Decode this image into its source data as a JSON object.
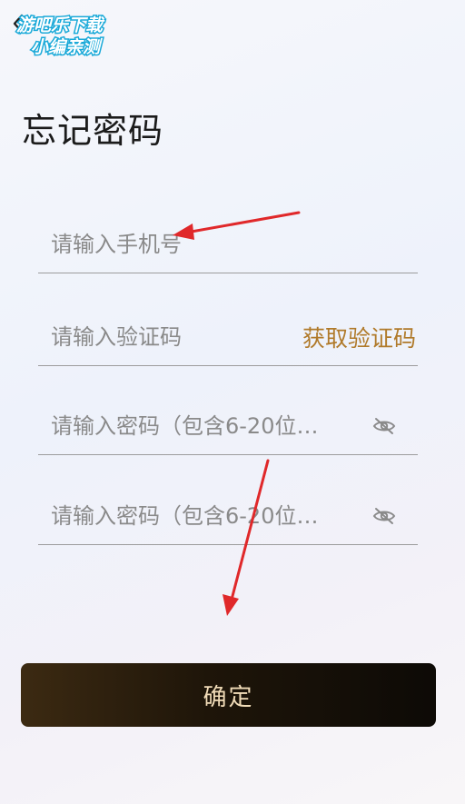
{
  "watermark": {
    "line1": "游吧乐下载",
    "line2": "小编亲测"
  },
  "page": {
    "title": "忘记密码"
  },
  "form": {
    "phone_placeholder": "请输入手机号",
    "code_placeholder": "请输入验证码",
    "get_code_label": "获取验证码",
    "password_placeholder": "请输入密码（包含6-20位…",
    "confirm_password_placeholder": "请输入密码（包含6-20位…"
  },
  "actions": {
    "confirm_label": "确定"
  },
  "colors": {
    "accent": "#b07a2a",
    "button_text": "#f1dcb8",
    "annotation_arrow": "#e0282a",
    "watermark": "#1aa9d8"
  },
  "icons": {
    "back": "chevron-left-icon",
    "password_visibility": "eye-off-icon"
  }
}
